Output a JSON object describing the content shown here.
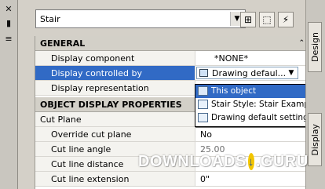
{
  "tools": [
    "close",
    "pin",
    "menu"
  ],
  "top": {
    "selector_value": "Stair",
    "buttons": [
      "add-selected",
      "quick-select",
      "edit-pickfirst"
    ]
  },
  "general": {
    "header": "GENERAL",
    "rows": [
      {
        "label": "Display component",
        "value": "*NONE*"
      },
      {
        "label": "Display controlled by",
        "value": "Drawing defaul..."
      },
      {
        "label": "Display representation",
        "value": ""
      }
    ]
  },
  "object_display": {
    "header": "OBJECT DISPLAY PROPERTIES",
    "subheader": "Cut Plane",
    "rows": [
      {
        "label": "Override cut plane",
        "value": "No"
      },
      {
        "label": "Cut line angle",
        "value": "25.00"
      },
      {
        "label": "Cut line distance",
        "value": ""
      },
      {
        "label": "Cut line extension",
        "value": "0\""
      }
    ]
  },
  "dropdown": {
    "items": [
      "This object",
      "Stair Style: Stair Example",
      "Drawing default setting"
    ],
    "active_index": 0
  },
  "side_tabs": [
    "Design",
    "Display"
  ],
  "watermark": {
    "left": "DOWNLOADS",
    "right": ".GURU"
  },
  "colors": {
    "selection": "#316ac5",
    "panel": "#d4d0c8",
    "watermark_accent": "#f2c500"
  }
}
